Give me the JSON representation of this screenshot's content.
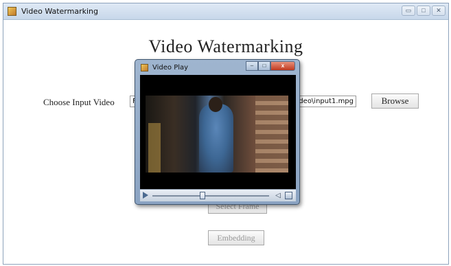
{
  "main_window": {
    "title": "Video Watermarking",
    "controls": {
      "minimize": "▭",
      "maximize": "□",
      "close": "✕"
    }
  },
  "main": {
    "heading": "Video Watermarking",
    "input_label": "Choose Input Video",
    "input_path_start": "F:\\",
    "input_path_end": "deo\\input1.mpg",
    "browse_label": "Browse",
    "select_frame_label": "Select Frame",
    "embedding_label": "Embedding"
  },
  "dialog": {
    "title": "Video Play",
    "controls": {
      "minimize": "–",
      "maximize": "□",
      "close": "x"
    },
    "seek_fraction": 0.43
  },
  "icons": {
    "app": "java-cup-icon",
    "play": "play-icon",
    "volume": "volume-icon",
    "volume_glyph": "◁",
    "menu": "control-menu-icon"
  },
  "colors": {
    "titlebar": "#c7d7ea",
    "dialog_frame": "#8aa3c2",
    "close_red": "#c0391f"
  }
}
